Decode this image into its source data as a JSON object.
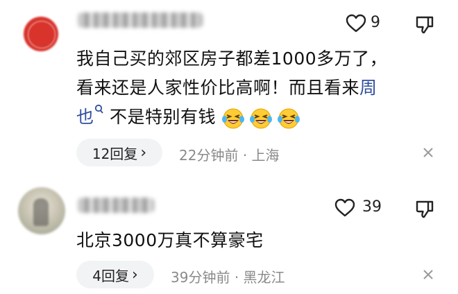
{
  "comments": [
    {
      "likes": "9",
      "line1": "我自己买的郊区房子都差1000多万了，",
      "line2": "看来还是人家性价比高啊！而且看来",
      "line2_link": "周",
      "line3_link": "也",
      "line3_text": "不是特别有钱",
      "emojis": [
        "laughing-crying",
        "laughing-crying",
        "laughing-crying"
      ],
      "reply_label": "12回复",
      "time": "22分钟前",
      "location": "上海"
    },
    {
      "likes": "39",
      "text": "北京3000万真不算豪宅",
      "reply_label": "4回复",
      "time": "39分钟前",
      "location": "黑龙江"
    }
  ],
  "separator": "·",
  "reply_chevron": "›",
  "colors": {
    "link": "#2f4e9c",
    "meta": "#8a8a8a",
    "pill_bg": "#f2f3f5"
  }
}
